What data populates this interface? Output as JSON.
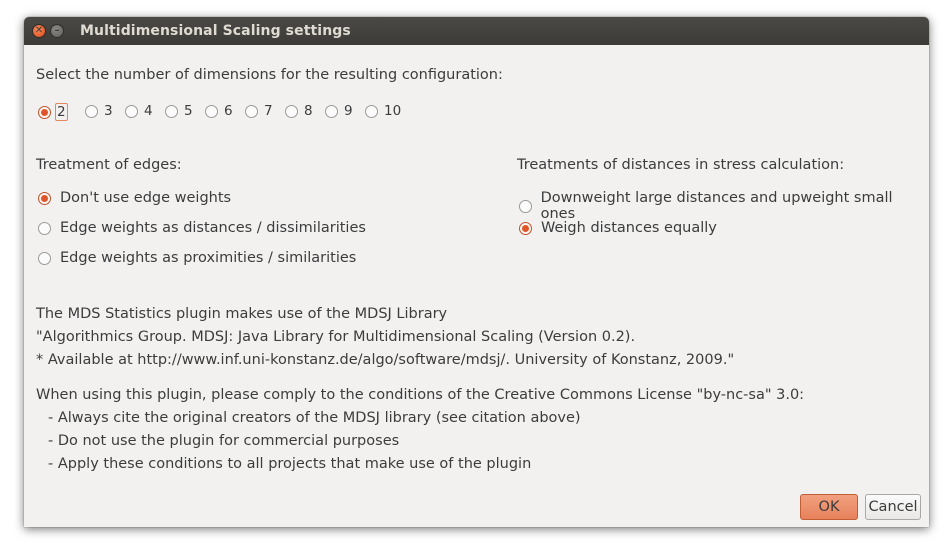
{
  "window": {
    "title": "Multidimensional Scaling settings"
  },
  "dimensions": {
    "prompt": "Select the number of dimensions for the resulting configuration:",
    "options": [
      "2",
      "3",
      "4",
      "5",
      "6",
      "7",
      "8",
      "9",
      "10"
    ],
    "selected": "2"
  },
  "edges": {
    "heading": "Treatment of edges:",
    "options": [
      {
        "label": "Don't use edge weights",
        "checked": true
      },
      {
        "label": "Edge weights as distances / dissimilarities",
        "checked": false
      },
      {
        "label": "Edge weights as proximities / similarities",
        "checked": false
      }
    ]
  },
  "stress": {
    "heading": "Treatments of distances in stress calculation:",
    "options": [
      {
        "label": "Downweight large distances and upweight small ones",
        "checked": false
      },
      {
        "label": "Weigh distances equally",
        "checked": true
      }
    ]
  },
  "info": {
    "line1": "The MDS Statistics plugin makes use of the MDSJ Library",
    "line2": "\"Algorithmics Group. MDSJ: Java Library for Multidimensional Scaling (Version 0.2).",
    "line3": "* Available at http://www.inf.uni-konstanz.de/algo/software/mdsj/. University of Konstanz, 2009.\"",
    "license": "When using this plugin, please comply to the conditions of the Creative Commons License \"by-nc-sa\" 3.0:",
    "cond1": "- Always cite the original creators of the MDSJ library (see citation above)",
    "cond2": "- Do not use the plugin for commercial purposes",
    "cond3": "- Apply these conditions to all projects that make use of the plugin"
  },
  "buttons": {
    "ok": "OK",
    "cancel": "Cancel"
  },
  "colors": {
    "accent": "#e0562a",
    "titlebar": "#3c3b37",
    "dialog_bg": "#f2f1f0"
  }
}
